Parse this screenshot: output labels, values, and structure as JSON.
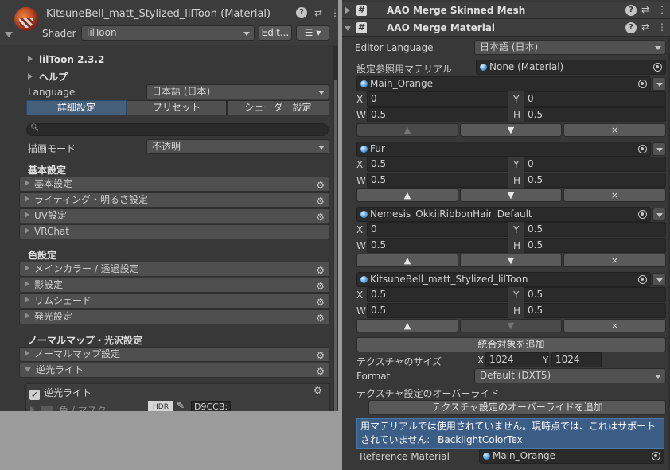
{
  "left": {
    "header": {
      "title": "KitsuneBell_matt_Stylized_lilToon (Material)",
      "shader_label": "Shader",
      "shader_value": "lilToon",
      "edit_button": "Edit...",
      "list_button": "☰ ▾"
    },
    "version": "lilToon 2.3.2",
    "help": "ヘルプ",
    "language_label": "Language",
    "language_value": "日本語 (日本)",
    "tabs": [
      "詳細設定",
      "プリセット",
      "シェーダー設定"
    ],
    "render_mode_label": "描画モード",
    "render_mode_value": "不透明",
    "groups": [
      {
        "title": "基本設定",
        "sections": [
          "基本設定",
          "ライティング・明るさ設定",
          "UV設定",
          "VRChat"
        ]
      },
      {
        "title": "色設定",
        "sections": [
          "メインカラー / 透過設定",
          "影設定",
          "リムシェード",
          "発光設定"
        ]
      },
      {
        "title": "ノーマルマップ・光沢設定",
        "sections": [
          "ノーマルマップ設定",
          "逆光ライト"
        ]
      }
    ],
    "backlight": {
      "toggle_label": "逆光ライト",
      "color_mask_label": "色 / マスク",
      "hdr_label": "HDR",
      "color_hex": "D9CCB:"
    }
  },
  "right": {
    "components": {
      "skinned_mesh": "AAO Merge Skinned Mesh",
      "merge_material": "AAO Merge Material"
    },
    "editor_language_label": "Editor Language",
    "editor_language_value": "日本語 (日本)",
    "ref_material_label": "設定参照用マテリアル",
    "ref_material_value": "None (Material)",
    "materials": [
      {
        "name": "Main_Orange",
        "x": "0",
        "y": "0",
        "w": "0.5",
        "h": "0.5",
        "up_enabled": false,
        "down_enabled": true
      },
      {
        "name": "Fur",
        "x": "0.5",
        "y": "0",
        "w": "0.5",
        "h": "0.5",
        "up_enabled": true,
        "down_enabled": true
      },
      {
        "name": "Nemesis_OkkiiRibbonHair_Default",
        "x": "0",
        "y": "0.5",
        "w": "0.5",
        "h": "0.5",
        "up_enabled": true,
        "down_enabled": true
      },
      {
        "name": "KitsuneBell_matt_Stylized_lilToon",
        "x": "0.5",
        "y": "0.5",
        "w": "0.5",
        "h": "0.5",
        "up_enabled": true,
        "down_enabled": false
      }
    ],
    "axis_labels": {
      "x": "X",
      "y": "Y",
      "w": "W",
      "h": "H"
    },
    "move_up": "▲",
    "move_down": "▼",
    "remove": "×",
    "add_merge_target": "統合対象を追加",
    "texture_size_label": "テクスチャのサイズ",
    "texture_size_x": "1024",
    "texture_size_y": "1024",
    "format_label": "Format",
    "format_value": "Default (DXT5)",
    "override_label": "テクスチャ設定のオーバーライド",
    "add_override": "テクスチャ設定のオーバーライドを追加",
    "warning_text": "用マテリアルでは使用されていません。現時点では、これはサポートされていません: _BacklightColorTex",
    "reference_material_label": "Reference Material",
    "reference_material_value": "Main_Orange"
  }
}
